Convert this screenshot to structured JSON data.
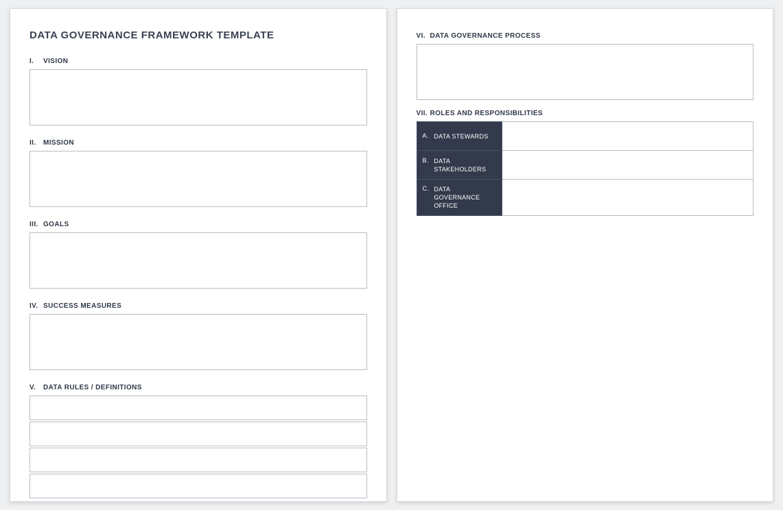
{
  "title": "DATA GOVERNANCE FRAMEWORK TEMPLATE",
  "left": {
    "sections": [
      {
        "num": "I.",
        "label": "VISION"
      },
      {
        "num": "II.",
        "label": "MISSION"
      },
      {
        "num": "III.",
        "label": "GOALS"
      },
      {
        "num": "IV.",
        "label": "SUCCESS MEASURES"
      },
      {
        "num": "V.",
        "label": "DATA RULES / DEFINITIONS"
      }
    ]
  },
  "right": {
    "process": {
      "num": "VI.",
      "label": "DATA GOVERNANCE PROCESS"
    },
    "roles": {
      "num": "VII.",
      "label": "ROLES AND RESPONSIBILITIES"
    },
    "roleRows": [
      {
        "num": "A.",
        "label": "DATA STEWARDS"
      },
      {
        "num": "B.",
        "label": "DATA STAKEHOLDERS"
      },
      {
        "num": "C.",
        "label": "DATA GOVERNANCE OFFICE"
      }
    ]
  }
}
